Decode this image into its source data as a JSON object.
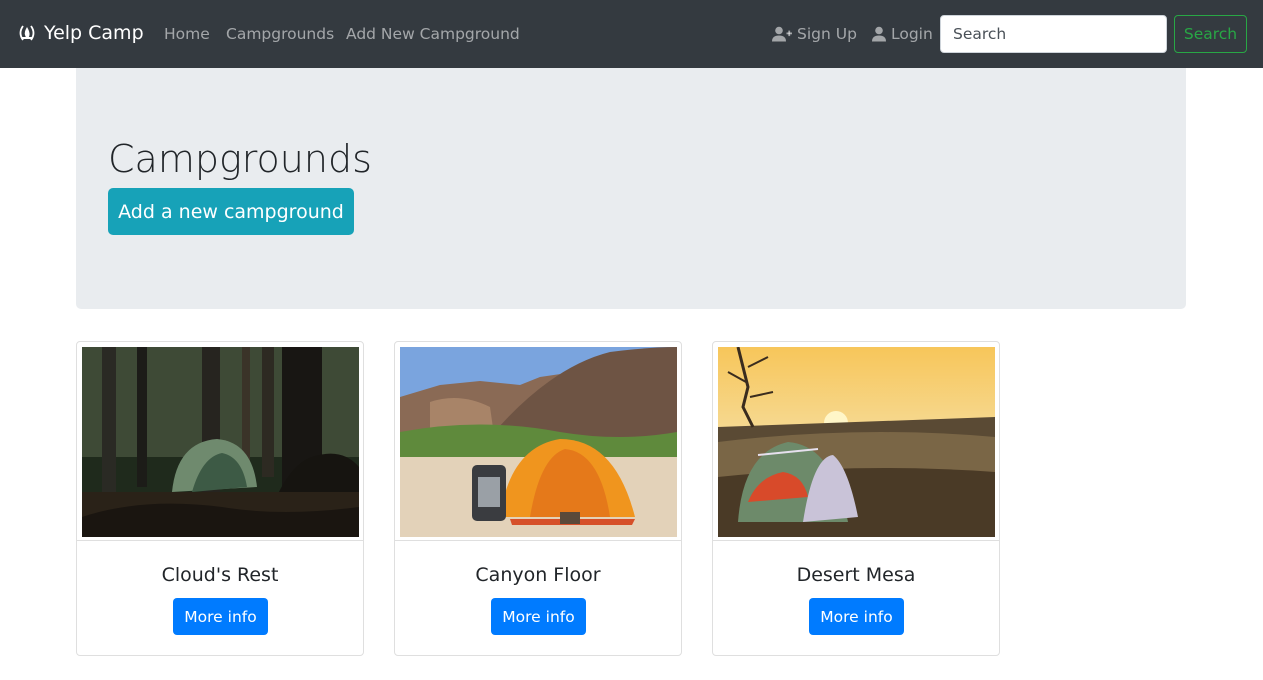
{
  "navbar": {
    "brand": "Yelp Camp",
    "brand_icon": "campfire-icon",
    "links": {
      "home": "Home",
      "campgrounds": "Campgrounds",
      "add_new": "Add New Campground"
    },
    "signup": "Sign Up",
    "signup_icon": "user-plus-icon",
    "login": "Login",
    "login_icon": "user-icon",
    "search_placeholder": "Search",
    "search_button": "Search"
  },
  "jumbotron": {
    "title": "Campgrounds",
    "button": "Add a new campground"
  },
  "campgrounds": [
    {
      "name": "Cloud's Rest",
      "button": "More info"
    },
    {
      "name": "Canyon Floor",
      "button": "More info"
    },
    {
      "name": "Desert Mesa",
      "button": "More info"
    }
  ],
  "colors": {
    "navbar": "#343a40",
    "jumbotron": "#e9ecef",
    "info_button": "#17a2b8",
    "primary_button": "#007bff",
    "success_outline": "#28a745"
  }
}
